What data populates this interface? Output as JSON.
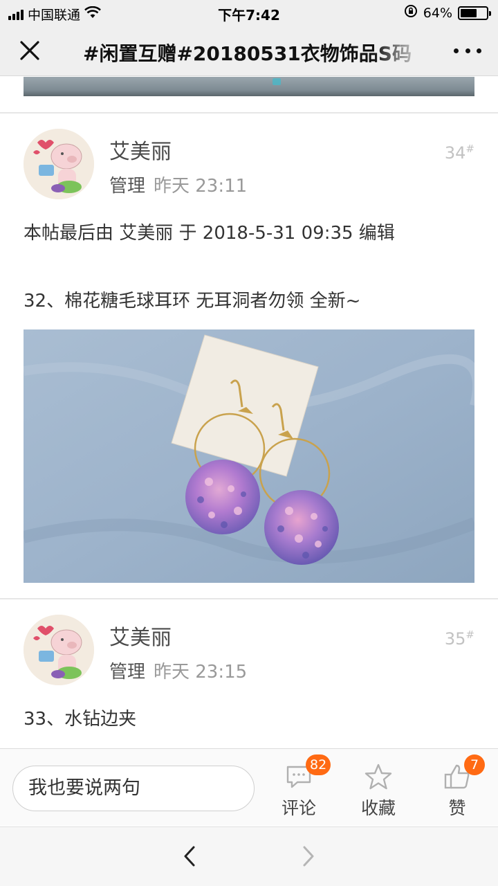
{
  "status_bar": {
    "carrier": "中国联通",
    "time": "下午7:42",
    "battery_text": "64%",
    "battery_level": 0.64
  },
  "nav": {
    "title": "#闲置互赠#20180531衣物饰品S码",
    "close_icon": "close-icon",
    "more_icon": "more-dots-icon"
  },
  "posts": [
    {
      "author": "艾美丽",
      "role": "管理",
      "time": "昨天 23:11",
      "floor": "34",
      "floor_mark": "#",
      "edit_note": "本帖最后由 艾美丽 于 2018-5-31 09:35 编辑",
      "text": "32、棉花糖毛球耳环   无耳洞者勿领  全新~",
      "photo_description": "earrings-photo"
    },
    {
      "author": "艾美丽",
      "role": "管理",
      "time": "昨天 23:15",
      "floor": "35",
      "floor_mark": "#",
      "text": "33、水钻边夹"
    }
  ],
  "action_bar": {
    "comment_placeholder": "我也要说两句",
    "comment_label": "评论",
    "comment_count": "82",
    "favorite_label": "收藏",
    "like_label": "赞",
    "like_count": "7",
    "badge_color": "#ff6a13"
  },
  "browser": {
    "back_icon": "chevron-left-icon",
    "forward_icon": "chevron-right-icon"
  }
}
